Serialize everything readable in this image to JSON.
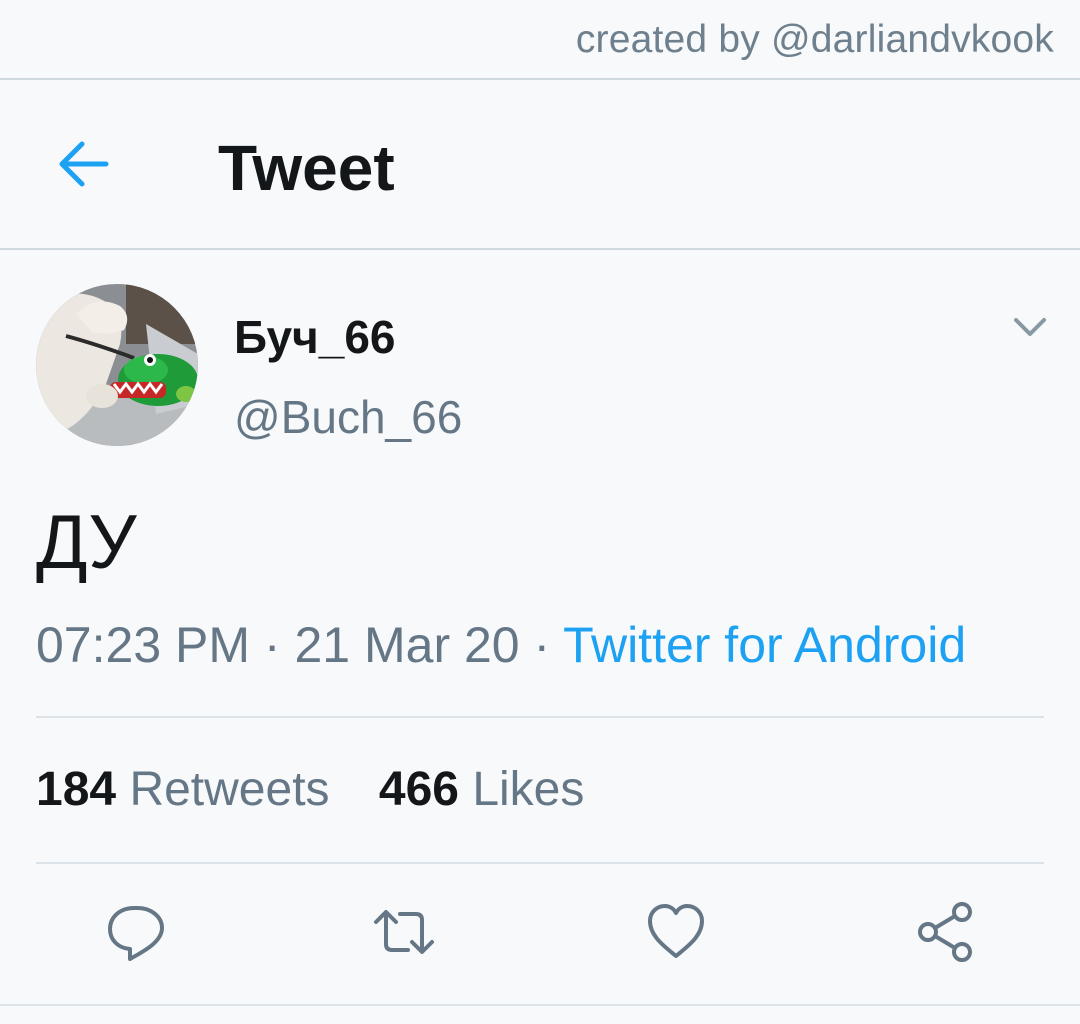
{
  "watermark": "created by @darliandvkook",
  "header": {
    "back_icon": "arrow-left-icon",
    "title": "Tweet"
  },
  "tweet": {
    "display_name": "Буч_66",
    "handle": "@Buch_66",
    "avatar": "avatar-dog-with-crocodile-toy",
    "menu_icon": "chevron-down-icon",
    "text": "ДУ",
    "time": "07:23 PM",
    "date": "21 Mar 20",
    "separator": "·",
    "source": "Twitter for Android",
    "stats": {
      "retweets_count": "184",
      "retweets_label": "Retweets",
      "likes_count": "466",
      "likes_label": "Likes"
    },
    "actions": {
      "reply_icon": "reply-icon",
      "retweet_icon": "retweet-icon",
      "like_icon": "heart-icon",
      "share_icon": "share-icon"
    }
  },
  "colors": {
    "accent": "#1da1f2",
    "text_primary": "#14171a",
    "text_secondary": "#657786",
    "background": "#f7f9fa",
    "divider": "#dce3e8"
  }
}
